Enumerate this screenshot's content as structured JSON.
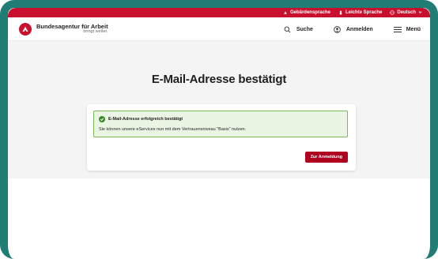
{
  "utility_bar": {
    "items": [
      {
        "label": "Gebärdensprache",
        "icon": "sign-language-icon"
      },
      {
        "label": "Leichte Sprache",
        "icon": "easy-language-icon"
      },
      {
        "label": "Deutsch",
        "icon": "globe-icon"
      }
    ],
    "color": "#c8102e"
  },
  "header": {
    "logo_title": "Bundesagentur für Arbeit",
    "logo_subtitle": "bringt weiter.",
    "actions": [
      {
        "label": "Suche",
        "icon": "search-icon"
      },
      {
        "label": "Anmelden",
        "icon": "user-icon"
      },
      {
        "label": "Menü",
        "icon": "menu-icon"
      }
    ]
  },
  "main": {
    "title": "E-Mail-Adresse bestätigt",
    "alert": {
      "title": "E-Mail-Adresse erfolgreich bestätigt",
      "text": "Sie können unsere eServices nun mit dem Vertrauensniveau \"Basis\" nutzen.",
      "status_color": "#3a8a2a"
    },
    "button_label": "Zur Anmeldung",
    "button_color": "#b00020"
  },
  "frame_color": "#1f7d75"
}
